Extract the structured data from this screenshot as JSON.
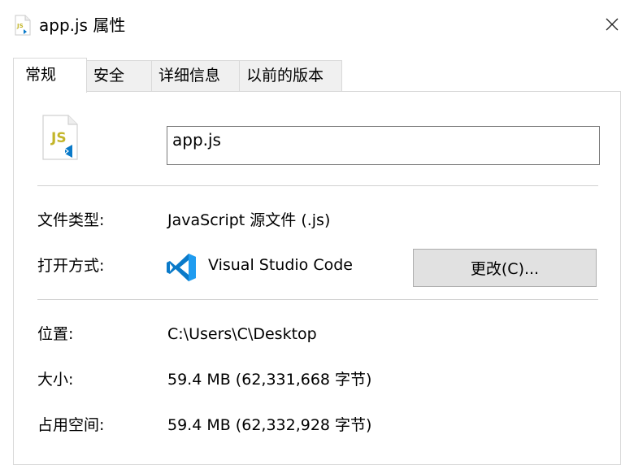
{
  "window": {
    "title": "app.js 属性",
    "close_icon": "close-icon"
  },
  "tabs": [
    {
      "label": "常规",
      "active": true
    },
    {
      "label": "安全",
      "active": false
    },
    {
      "label": "详细信息",
      "active": false
    },
    {
      "label": "以前的版本",
      "active": false
    }
  ],
  "general": {
    "file_icon": "js-file-icon",
    "file_icon_text": "JS",
    "file_name": "app.js",
    "file_type_label": "文件类型:",
    "file_type_value": "JavaScript 源文件 (.js)",
    "open_with_label": "打开方式:",
    "open_with_icon": "vscode-icon",
    "open_with_value": "Visual Studio Code",
    "change_button": "更改(C)...",
    "location_label": "位置:",
    "location_value": "C:\\Users\\C\\Desktop",
    "size_label": "大小:",
    "size_value": "59.4 MB (62,331,668 字节)",
    "size_on_disk_label": "占用空间:",
    "size_on_disk_value": "59.4 MB (62,332,928 字节)"
  },
  "colors": {
    "js_badge": "#c3b52a",
    "vscode_blue": "#0a7ac9",
    "button_bg": "#e1e1e1",
    "tab_bg": "#f0f0f0"
  }
}
